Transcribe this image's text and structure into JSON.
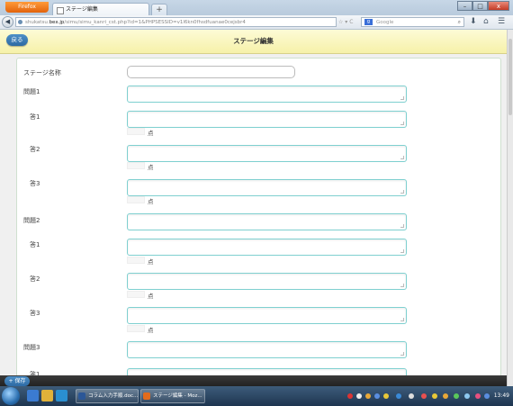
{
  "browser": {
    "app_button": "Firefox",
    "tab_title": "ステージ編集",
    "new_tab": "+",
    "url_domain": "shukatsu.bex.jp",
    "url_prefix": "shukatsu.",
    "url_rest": "/simu/simu_kanri_cst.php?id=1&PHPSESSID=v1l6kn0fhsdfuanae0cejsbr4",
    "search_placeholder": "Google",
    "window_controls": {
      "min": "–",
      "max": "□",
      "close": "x"
    }
  },
  "header": {
    "back_label": "戻る",
    "title": "ステージ編集"
  },
  "form": {
    "stage_name_label": "ステージ名称",
    "points_label": "点",
    "questions": [
      {
        "label": "問題1",
        "answers": [
          "答1",
          "答2",
          "答3"
        ]
      },
      {
        "label": "問題2",
        "answers": [
          "答1",
          "答2",
          "答3"
        ]
      },
      {
        "label": "問題3",
        "answers": [
          "答1"
        ]
      }
    ]
  },
  "footer": {
    "save_label": "保存"
  },
  "taskbar": {
    "tasks": [
      "コラム入力手順.doc...",
      "ステージ編集 - Moz..."
    ],
    "clock": "13:49"
  },
  "colors": {
    "header_bg": "#f6f1a9",
    "button_blue": "#2d6aa3",
    "field_border": "#7fd0d0"
  }
}
